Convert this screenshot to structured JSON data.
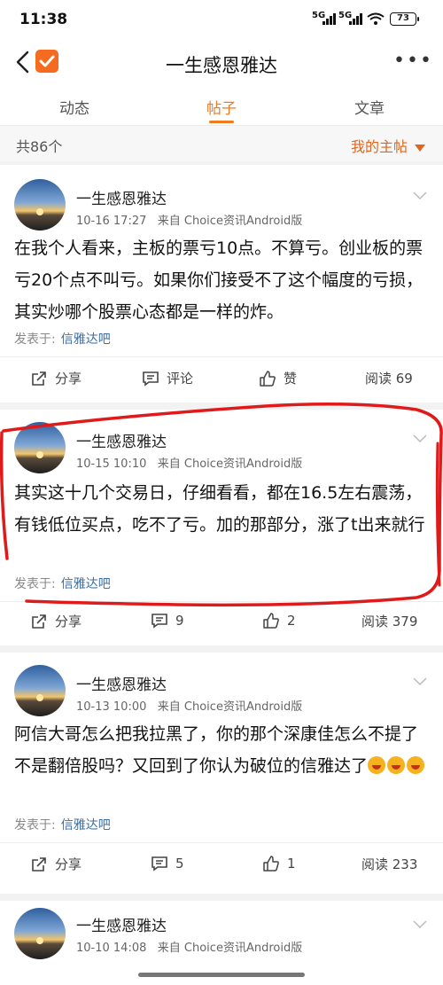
{
  "status": {
    "time": "11:38",
    "sig1": "5G",
    "sig2": "5G",
    "battery": "73"
  },
  "header": {
    "title": "一生感恩雅达"
  },
  "tabs": [
    {
      "label": "动态",
      "active": false
    },
    {
      "label": "帖子",
      "active": true
    },
    {
      "label": "文章",
      "active": false
    }
  ],
  "countbar": {
    "count": "共86个",
    "filter": "我的主帖"
  },
  "posts": [
    {
      "user": "一生感恩雅达",
      "date": "10-16 17:27",
      "source": "来自 Choice资讯Android版",
      "text": "在我个人看来，主板的票亏10点。不算亏。创业板的票亏20个点不叫亏。如果你们接受不了这个幅度的亏损，其实炒哪个股票心态都是一样的炸。",
      "posted_label": "发表于:",
      "forum": "信雅达吧",
      "share": "分享",
      "comment": "评论",
      "like": "赞",
      "reads": "阅读 69"
    },
    {
      "user": "一生感恩雅达",
      "date": "10-15 10:10",
      "source": "来自 Choice资讯Android版",
      "text": "其实这十几个交易日，仔细看看，都在16.5左右震荡，有钱低位买点，吃不了亏。加的那部分，涨了t出来就行",
      "posted_label": "发表于:",
      "forum": "信雅达吧",
      "share": "分享",
      "comment": "9",
      "like": "2",
      "reads": "阅读 379"
    },
    {
      "user": "一生感恩雅达",
      "date": "10-13 10:00",
      "source": "来自 Choice资讯Android版",
      "text": "阿信大哥怎么把我拉黑了，你的那个深康佳怎么不提了不是翻倍股吗？又回到了你认为破位的信雅达了",
      "posted_label": "发表于:",
      "forum": "信雅达吧",
      "share": "分享",
      "comment": "5",
      "like": "1",
      "reads": "阅读 233"
    },
    {
      "user": "一生感恩雅达",
      "date": "10-10 14:08",
      "source": "来自 Choice资讯Android版"
    }
  ],
  "colors": {
    "accent": "#f07a1e",
    "link": "#3a6ea5",
    "annotation": "#e01a1a"
  },
  "icons": [
    "back-icon",
    "app-badge-icon",
    "more-icon",
    "share-icon",
    "comment-icon",
    "like-icon",
    "chevron-down-icon",
    "laughing-emoji-icon"
  ]
}
